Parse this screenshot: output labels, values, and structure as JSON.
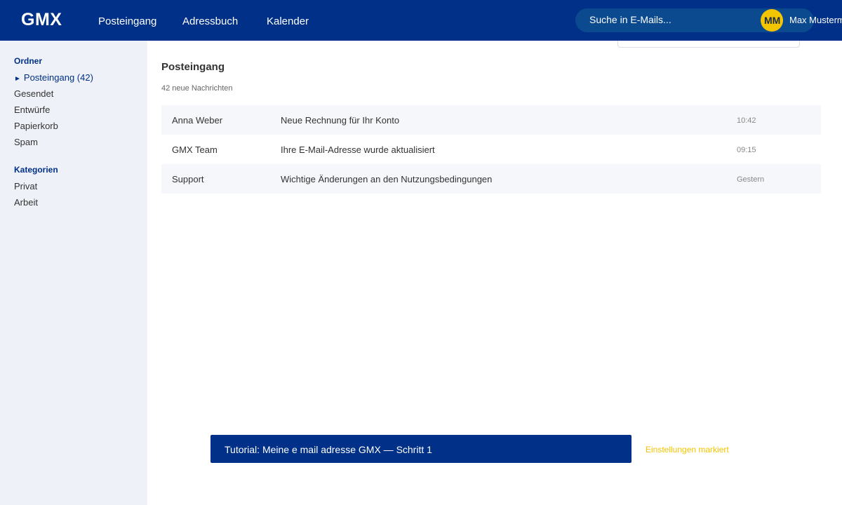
{
  "header": {
    "logo": "GMX",
    "nav": [
      "Posteingang",
      "Adressbuch",
      "Kalender"
    ],
    "search_placeholder": "Suche in E-Mails...",
    "avatar_initials": "MM",
    "user_name": "Max Mustermann"
  },
  "sidebar": {
    "folders_heading": "Ordner",
    "folders": [
      {
        "label": "Posteingang (42)",
        "active": true,
        "icon": "triangle-right-icon"
      },
      {
        "label": "Gesendet"
      },
      {
        "label": "Entwürfe"
      },
      {
        "label": "Papierkorb"
      },
      {
        "label": "Spam"
      }
    ],
    "categories_heading": "Kategorien",
    "categories": [
      "Privat",
      "Arbeit"
    ]
  },
  "main": {
    "title": "Posteingang",
    "subtitle": "42 neue Nachrichten",
    "messages": [
      {
        "sender": "Anna Weber",
        "subject": "Neue Rechnung für Ihr Konto",
        "time": "10:42"
      },
      {
        "sender": "GMX Team",
        "subject": "Ihre E-Mail-Adresse wurde aktualisiert",
        "time": "09:15"
      },
      {
        "sender": "Support",
        "subject": "Wichtige Änderungen an den Nutzungsbedingungen",
        "time": "Gestern"
      }
    ]
  },
  "tutorial": {
    "label": "Tutorial: Meine e mail adresse GMX — Schritt 1",
    "hint": "Einstellungen markiert"
  },
  "colors": {
    "brand": "#003087",
    "accent": "#f3c400",
    "sidebar_bg": "#eef1f7"
  }
}
